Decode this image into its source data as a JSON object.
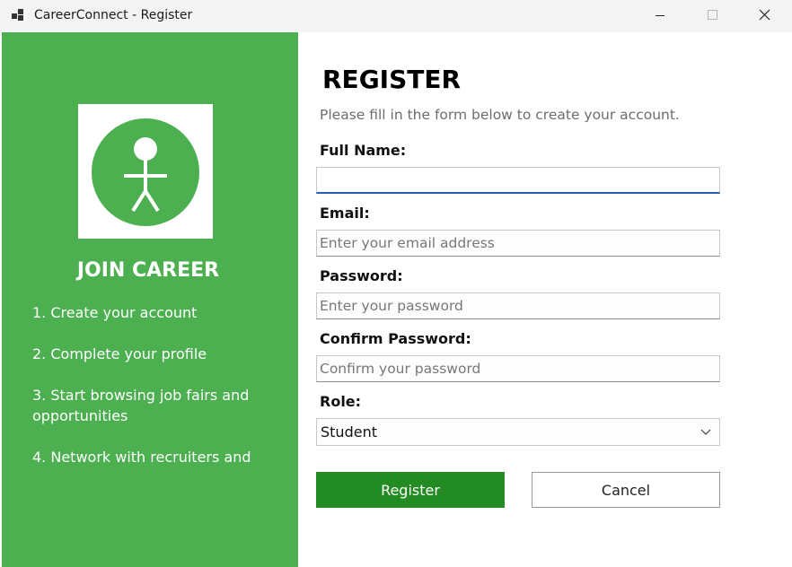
{
  "window": {
    "title": "CareerConnect - Register",
    "icons": {
      "app": "app-icon",
      "minimize": "minimize-icon",
      "maximize": "maximize-icon",
      "close": "close-icon"
    }
  },
  "sidebar": {
    "background_color": "#4caf50",
    "logo_icon": "person-icon",
    "heading": "JOIN CAREER",
    "steps": [
      "1. Create your account",
      "2. Complete your profile",
      "3. Start browsing job fairs and opportunities",
      "4. Network with recruiters and"
    ]
  },
  "form": {
    "title": "REGISTER",
    "subtitle": "Please fill in the form below to create your account.",
    "full_name": {
      "label": "Full Name:",
      "value": "",
      "placeholder": ""
    },
    "email": {
      "label": "Email:",
      "value": "",
      "placeholder": "Enter your email address"
    },
    "password": {
      "label": "Password:",
      "value": "",
      "placeholder": "Enter your password"
    },
    "confirm_password": {
      "label": "Confirm Password:",
      "value": "",
      "placeholder": "Confirm your password"
    },
    "role": {
      "label": "Role:",
      "selected": "Student",
      "icon": "chevron-down-icon"
    },
    "register_button": "Register",
    "cancel_button": "Cancel",
    "accent_color": "#228b22",
    "focus_color": "#1f5fae"
  }
}
